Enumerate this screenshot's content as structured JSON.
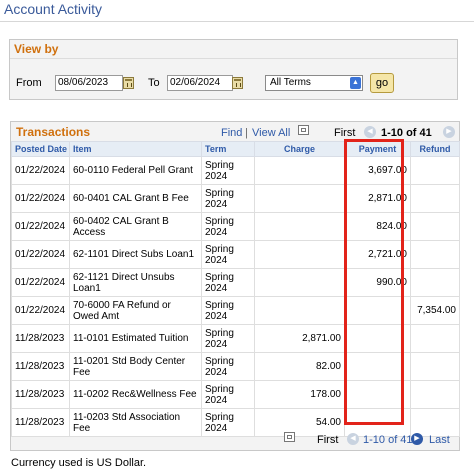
{
  "page": {
    "title": "Account Activity"
  },
  "view_by": {
    "title": "View by",
    "from_label": "From",
    "from_value": "08/06/2023",
    "to_label": "To",
    "to_value": "02/06/2024",
    "term_selected": "All Terms",
    "go_label": "go"
  },
  "transactions": {
    "title": "Transactions",
    "find_label": "Find",
    "separator": "|",
    "view_all_label": "View All",
    "first_label": "First",
    "range_label": "1-10 of 41",
    "last_label": "Last",
    "columns": {
      "posted_date": "Posted Date",
      "item": "Item",
      "term": "Term",
      "charge": "Charge",
      "payment": "Payment",
      "refund": "Refund"
    },
    "rows": [
      {
        "date": "01/22/2024",
        "item": "60-0110 Federal Pell Grant",
        "term": "Spring 2024",
        "charge": "",
        "payment": "3,697.00",
        "refund": ""
      },
      {
        "date": "01/22/2024",
        "item": "60-0401 CAL Grant B Fee",
        "term": "Spring 2024",
        "charge": "",
        "payment": "2,871.00",
        "refund": ""
      },
      {
        "date": "01/22/2024",
        "item": "60-0402 CAL Grant B Access",
        "term": "Spring 2024",
        "charge": "",
        "payment": "824.00",
        "refund": ""
      },
      {
        "date": "01/22/2024",
        "item": "62-1101 Direct Subs Loan1",
        "term": "Spring 2024",
        "charge": "",
        "payment": "2,721.00",
        "refund": ""
      },
      {
        "date": "01/22/2024",
        "item": "62-1121 Direct Unsubs Loan1",
        "term": "Spring 2024",
        "charge": "",
        "payment": "990.00",
        "refund": ""
      },
      {
        "date": "01/22/2024",
        "item": "70-6000 FA Refund or Owed Amt",
        "term": "Spring 2024",
        "charge": "",
        "payment": "",
        "refund": "7,354.00"
      },
      {
        "date": "11/28/2023",
        "item": "11-0101 Estimated Tuition",
        "term": "Spring 2024",
        "charge": "2,871.00",
        "payment": "",
        "refund": ""
      },
      {
        "date": "11/28/2023",
        "item": "11-0201 Std Body Center Fee",
        "term": "Spring 2024",
        "charge": "82.00",
        "payment": "",
        "refund": ""
      },
      {
        "date": "11/28/2023",
        "item": "11-0202 Rec&Wellness Fee",
        "term": "Spring 2024",
        "charge": "178.00",
        "payment": "",
        "refund": ""
      },
      {
        "date": "11/28/2023",
        "item": "11-0203 Std Association Fee",
        "term": "Spring 2024",
        "charge": "54.00",
        "payment": "",
        "refund": ""
      }
    ]
  },
  "footnote": "Currency used is US Dollar.",
  "colors": {
    "accent_orange": "#d0700d",
    "link_blue": "#2f5aa8",
    "highlight_red": "#e2231a"
  }
}
